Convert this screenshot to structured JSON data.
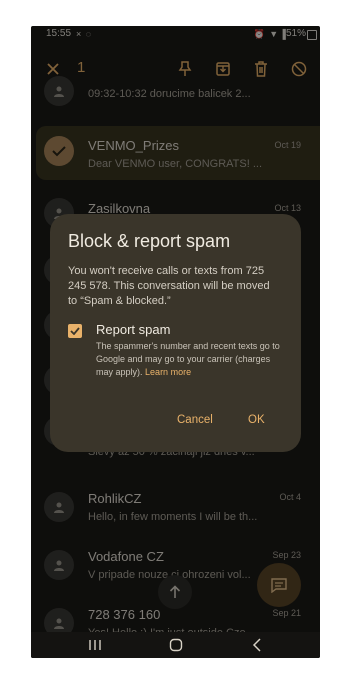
{
  "status_bar": {
    "time": "15:55",
    "left_icons": "× ◌",
    "right_icons": "⏰ ▼ ▌",
    "battery": "51%"
  },
  "action_bar": {
    "selected_count": "1"
  },
  "conversations": [
    {
      "name": "",
      "snippet": "09:32-10:32 dorucime balicek 2...",
      "date": ""
    },
    {
      "name": "VENMO_Prizes",
      "snippet": "Dear VENMO user, CONGRATS! ...",
      "date": "Oct 19",
      "selected": true
    },
    {
      "name": "Zasilkovna",
      "snippet": "",
      "date": "Oct 13"
    },
    {
      "name": "",
      "snippet": "Slevy az 50 % zacinaji jiz dnes v...",
      "date": ""
    },
    {
      "name": "RohlikCZ",
      "snippet": "Hello, in few moments I will be th...",
      "date": "Oct 4"
    },
    {
      "name": "Vodafone CZ",
      "snippet": "V pripade nouze ci ohrozeni vol...",
      "date": "Sep 23"
    },
    {
      "name": "728 376 160",
      "snippet": "Yes! Hello :) I'm just outside Cze...",
      "date": "Sep 21"
    }
  ],
  "dialog": {
    "title": "Block & report spam",
    "body": "You won't receive calls or texts from 725 245 578. This conversation will be moved to “Spam & blocked.”",
    "checkbox_label": "Report spam",
    "checkbox_checked": true,
    "checkbox_desc": "The spammer's number and recent texts go to Google and may go to your carrier (charges may apply).",
    "learn_more": "Learn more",
    "cancel_label": "Cancel",
    "ok_label": "OK"
  },
  "colors": {
    "accent": "#e9b26a",
    "background": "#1b1a17",
    "dialog": "#3a352a",
    "fab": "#5a4527"
  }
}
